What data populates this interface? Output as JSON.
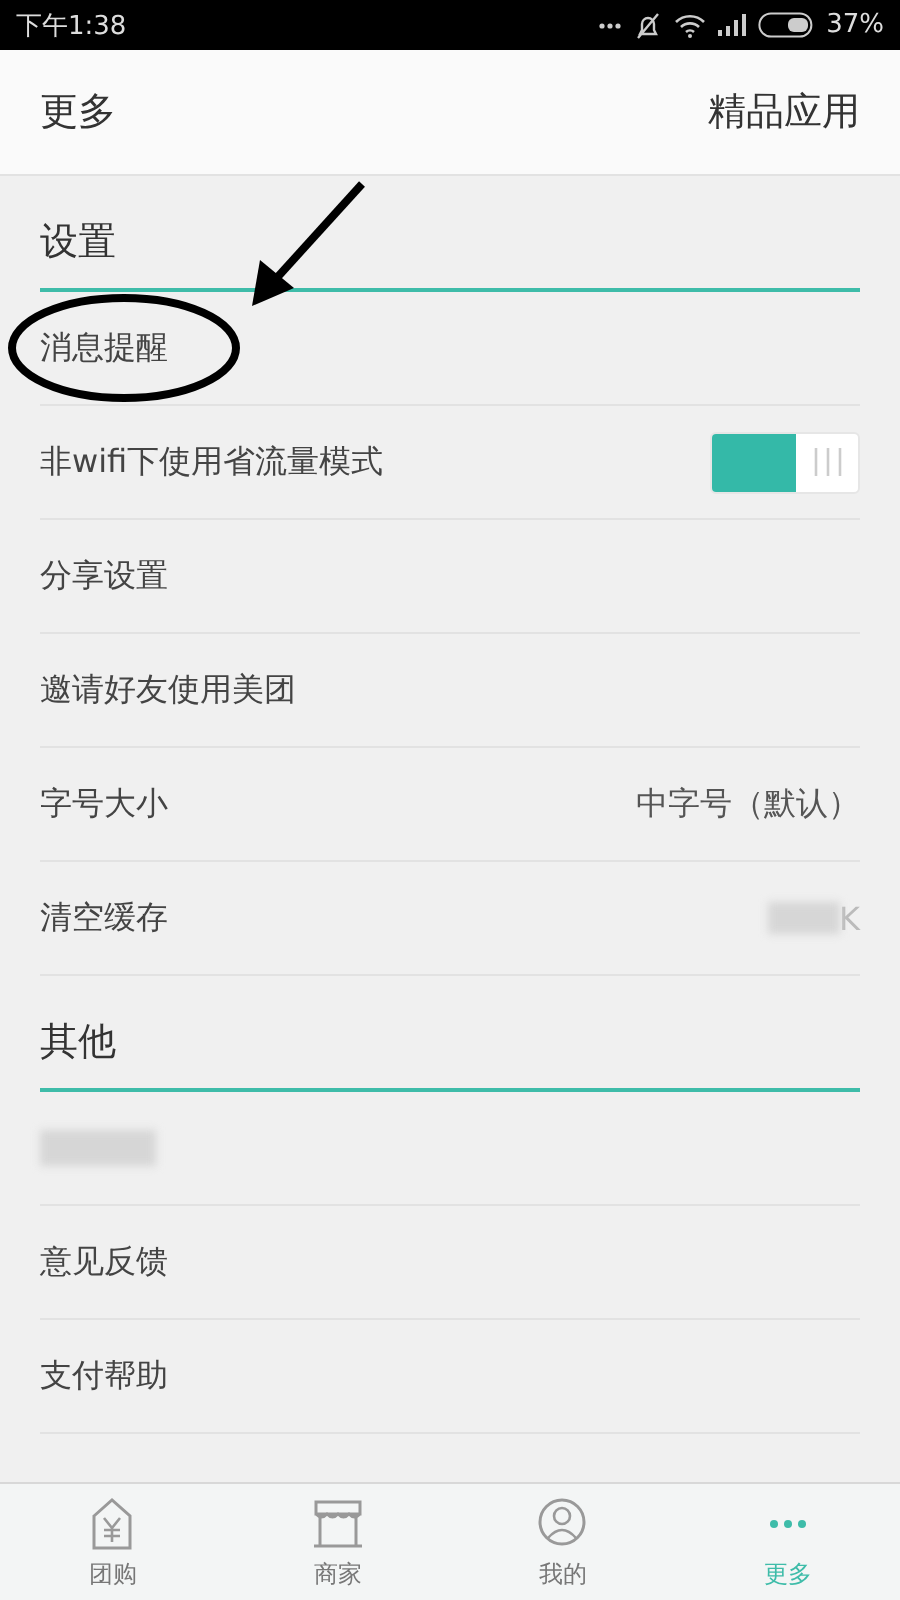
{
  "status_bar": {
    "time": "下午1:38",
    "battery": "37%"
  },
  "header": {
    "title": "更多",
    "action": "精品应用"
  },
  "sections": [
    {
      "title": "设置",
      "rows": [
        {
          "kind": "plain",
          "label": "消息提醒"
        },
        {
          "kind": "toggle",
          "label": "非wifi下使用省流量模式",
          "on": true
        },
        {
          "kind": "plain",
          "label": "分享设置"
        },
        {
          "kind": "plain",
          "label": "邀请好友使用美团"
        },
        {
          "kind": "value",
          "label": "字号大小",
          "value": "中字号（默认）"
        },
        {
          "kind": "blurred-value",
          "label": "清空缓存",
          "value": "K"
        }
      ]
    },
    {
      "title": "其他",
      "rows": [
        {
          "kind": "blurred"
        },
        {
          "kind": "plain",
          "label": "意见反馈"
        },
        {
          "kind": "plain",
          "label": "支付帮助"
        }
      ]
    }
  ],
  "tabs": [
    {
      "kind": "tag",
      "label": "团购",
      "selected": false
    },
    {
      "kind": "shop",
      "label": "商家",
      "selected": false
    },
    {
      "kind": "person",
      "label": "我的",
      "selected": false
    },
    {
      "kind": "more",
      "label": "更多",
      "selected": true
    }
  ]
}
